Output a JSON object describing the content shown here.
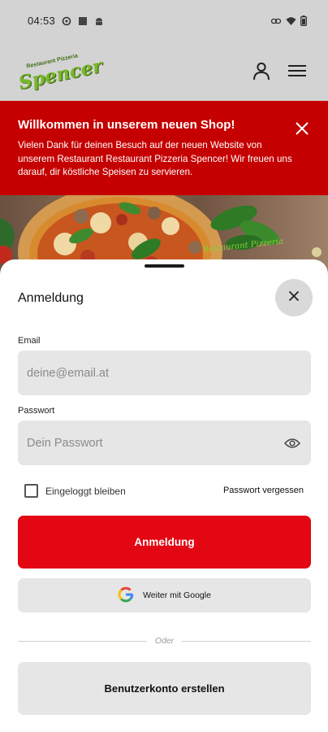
{
  "status_bar": {
    "time": "04:53",
    "left_icons": [
      "sync-icon",
      "square-icon",
      "android-icon"
    ],
    "right_icons": [
      "link-icon",
      "wifi-icon",
      "battery-icon"
    ]
  },
  "header": {
    "logo_top_text": "Restaurant Pizzeria",
    "logo_text": "Spencer",
    "icons": [
      "user-icon",
      "menu-icon"
    ]
  },
  "banner": {
    "title": "Willkommen in unserem neuen Shop!",
    "text": "Vielen Dank für deinen Besuch auf der neuen Website von unserem Restaurant Restaurant Pizzeria Spencer! Wir freuen uns darauf, dir köstliche Speisen zu servieren.",
    "background": "#c50000"
  },
  "hero": {
    "image_text": "Restaurant Pizzeria"
  },
  "login": {
    "title": "Anmeldung",
    "email_label": "Email",
    "email_placeholder": "deine@email.at",
    "email_value": "",
    "password_label": "Passwort",
    "password_placeholder": "Dein Passwort",
    "password_value": "",
    "remember_label": "Eingeloggt bleiben",
    "remember_checked": false,
    "forgot_label": "Passwort vergessen",
    "submit_label": "Anmeldung",
    "google_label": "Weiter mit Google",
    "divider_text": "Oder",
    "create_account_label": "Benutzerkonto erstellen"
  },
  "colors": {
    "accent": "#e30613",
    "input_bg": "#e6e6e6",
    "logo_green": "#77b829"
  }
}
